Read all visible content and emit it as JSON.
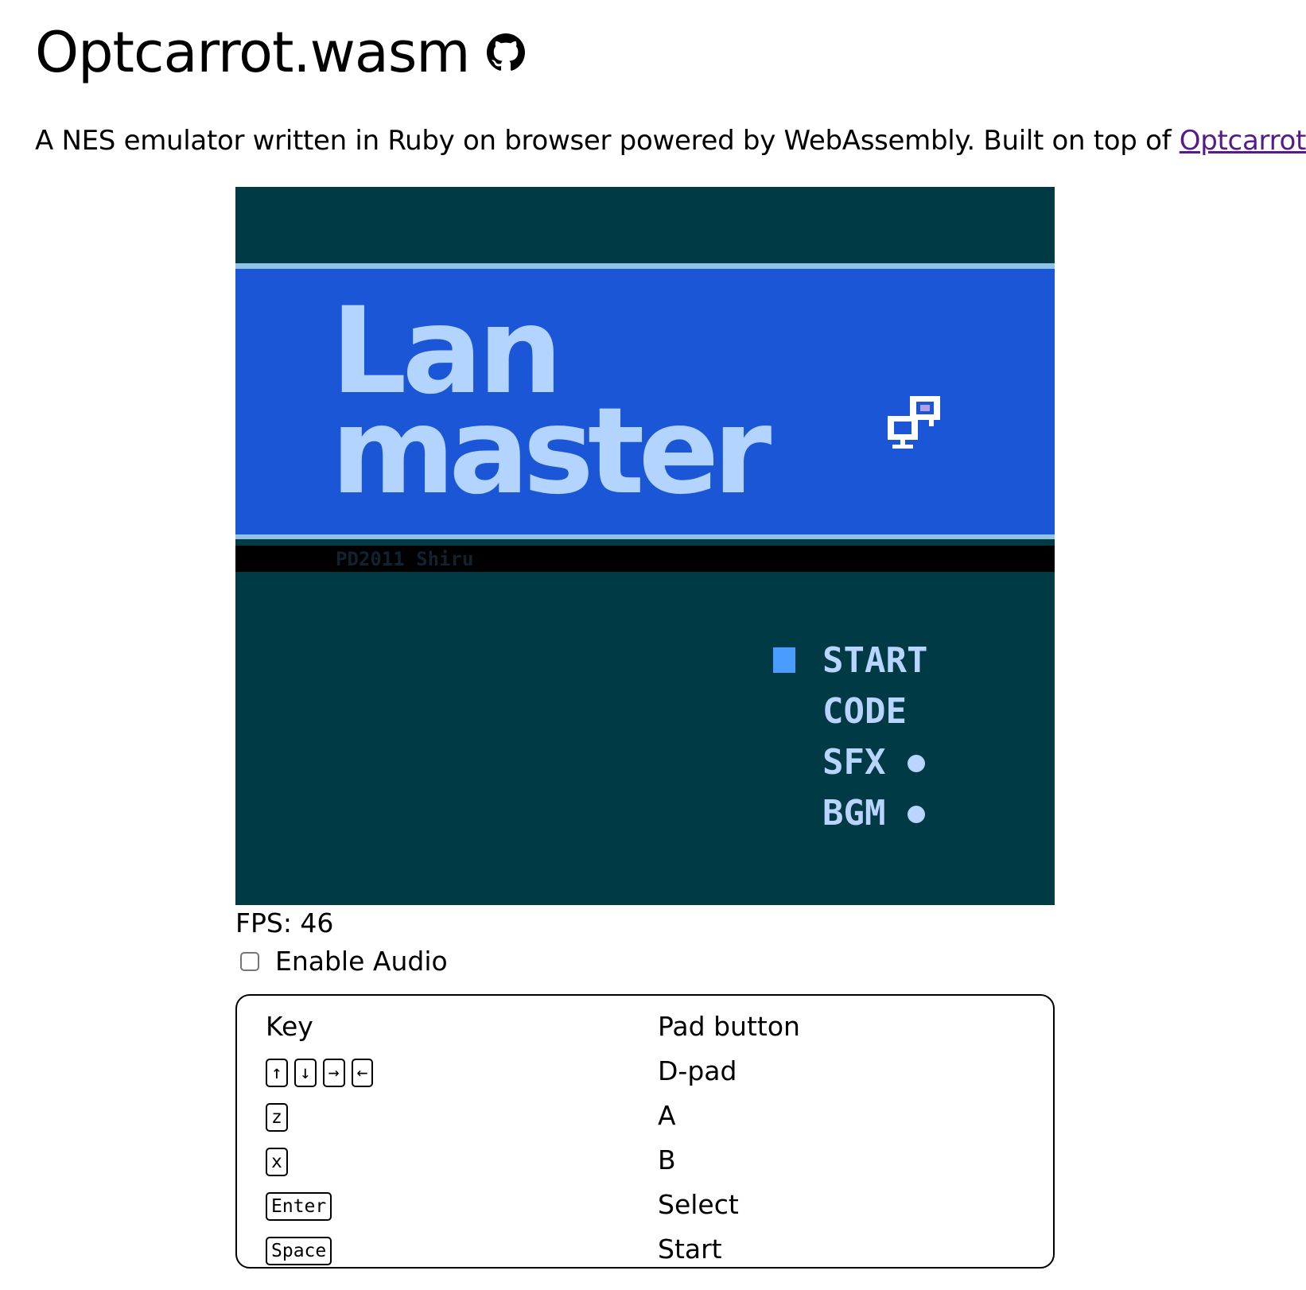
{
  "header": {
    "title": "Optcarrot.wasm",
    "github_icon": "github-icon"
  },
  "description": {
    "text": "A NES emulator written in Ruby on browser powered by WebAssembly. Built on top of ",
    "link_label": "Optcarrot"
  },
  "game_screen": {
    "title_line1": "Lan",
    "title_line2": "master",
    "copyright": "PD2011 Shiru",
    "menu": [
      "START",
      "CODE",
      "SFX",
      "BGM"
    ],
    "logo_icon": "computer-network-icon",
    "colors": {
      "background": "#003a45",
      "banner": "#1a56d6",
      "title_text": "#b3d4ff",
      "menu_text": "#b8d4ff",
      "cursor": "#4a9cff",
      "strip": "#000000"
    }
  },
  "status": {
    "fps_label": "FPS: 46"
  },
  "audio": {
    "label": "Enable Audio",
    "checked": false
  },
  "key_table": {
    "headers": [
      "Key",
      "Pad button"
    ],
    "rows": [
      {
        "keys": [
          "↑",
          "↓",
          "→",
          "←"
        ],
        "button": "D-pad"
      },
      {
        "keys": [
          "z"
        ],
        "button": "A"
      },
      {
        "keys": [
          "x"
        ],
        "button": "B"
      },
      {
        "keys": [
          "Enter"
        ],
        "button": "Select"
      },
      {
        "keys": [
          "Space"
        ],
        "button": "Start"
      }
    ]
  }
}
